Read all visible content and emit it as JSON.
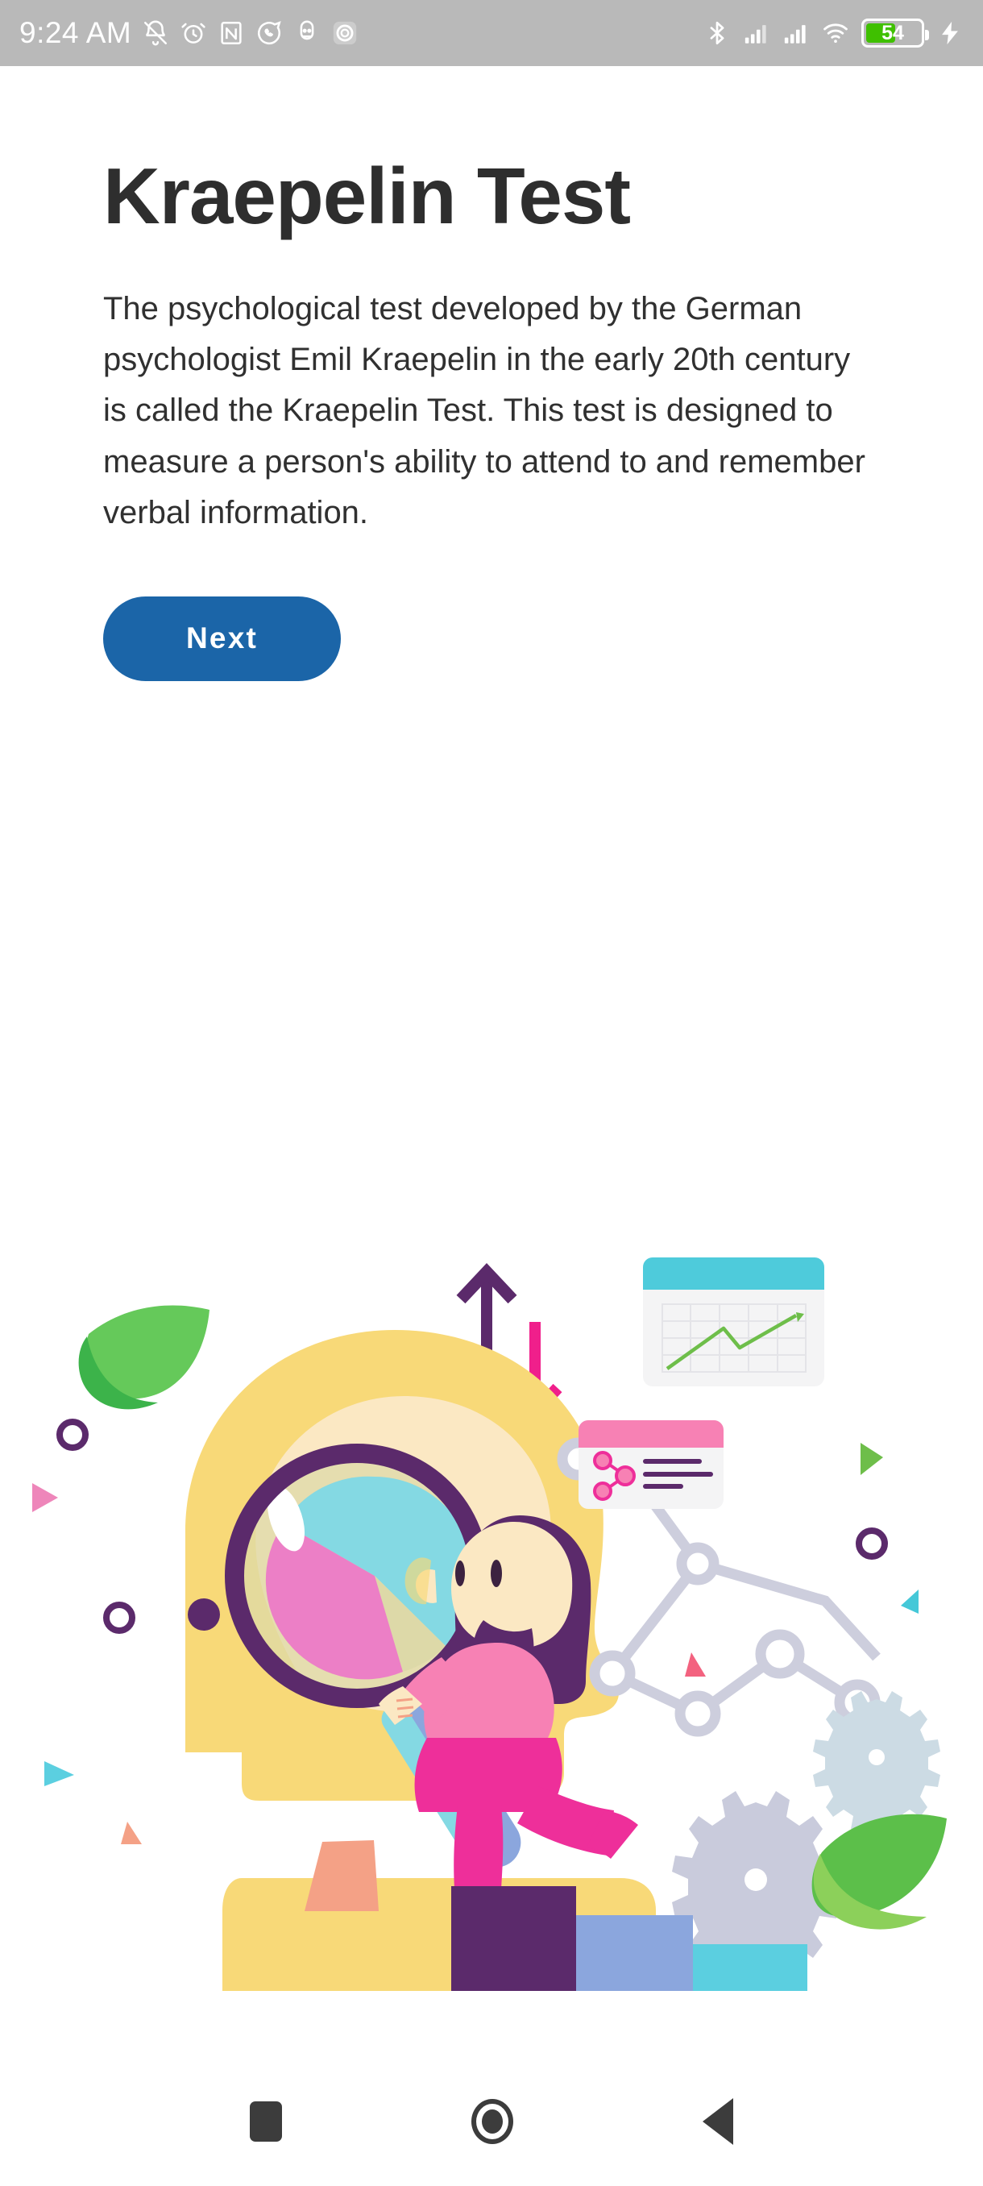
{
  "statusbar": {
    "time": "9:24 AM",
    "left_icons": [
      "bell-off-icon",
      "alarm-icon",
      "nfc-icon",
      "whatsapp-icon",
      "app-icon",
      "screen-record-icon"
    ],
    "right_icons": [
      "bluetooth-icon",
      "signal-sim1-icon",
      "signal-sim2-icon",
      "wifi-icon"
    ],
    "battery_percent": "54",
    "battery_level": 54,
    "battery_color": "#3fc000",
    "charging": true,
    "bar_color": "#b9b9b9"
  },
  "main": {
    "title": "Kraepelin Test",
    "description": "The psychological test developed by the German psychologist Emil Kraepelin in the early 20th century is called the Kraepelin Test. This test is designed to measure a person's ability to attend to and remember verbal information.",
    "next_label": "Next",
    "next_color": "#1b65a8",
    "title_color": "#2e2e2e"
  },
  "illustration": {
    "name": "data-analysis-head-illustration",
    "colors": {
      "head_yellow": "#f8d978",
      "head_cream": "#fbe8c3",
      "magnifier_purple": "#5b2a6b",
      "pie_cyan": "#84d9e3",
      "pie_pink": "#ec7fc6",
      "pie_khaki": "#ddd9a8",
      "leaf_green": "#5cbf4a",
      "accent_magenta": "#f01f8b",
      "bar_purple": "#5b2a6b",
      "bar_blue": "#8ba6dd",
      "bar_cyan": "#5bcfe0",
      "gear_gray": "#c9cbdc",
      "gear_bluegray": "#ccdbe4",
      "card_header_cyan": "#4ecbdb",
      "card_header_pink": "#f781b4",
      "node_gray": "#cdcedd",
      "chart_line_green": "#6ebe4a",
      "salmon": "#f4a186"
    },
    "chart_card_label": "line-chart-card",
    "network_card_label": "network-card",
    "bars": [
      {
        "name": "bar-purple",
        "height_ratio": 1.0
      },
      {
        "name": "bar-blue",
        "height_ratio": 0.72
      },
      {
        "name": "bar-cyan",
        "height_ratio": 0.45
      }
    ]
  },
  "navbar": {
    "recents_label": "recents-button",
    "home_label": "home-button",
    "back_label": "back-button",
    "icon_color": "#3c3c3c"
  }
}
